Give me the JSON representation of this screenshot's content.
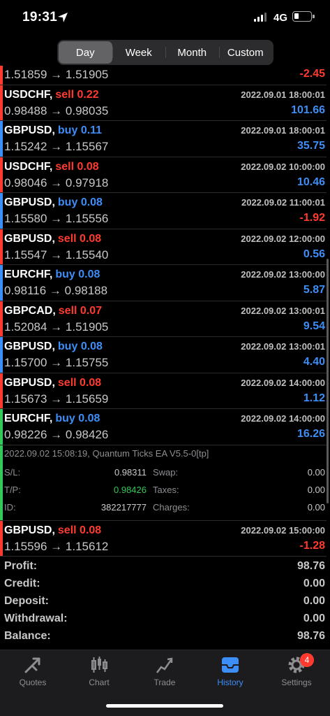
{
  "status_bar": {
    "time": "19:31",
    "network": "4G"
  },
  "period_tabs": [
    {
      "label": "Day",
      "active": true
    },
    {
      "label": "Week",
      "active": false
    },
    {
      "label": "Month",
      "active": false
    },
    {
      "label": "Custom",
      "active": false
    }
  ],
  "deals": [
    {
      "symbol": "",
      "side": "",
      "volume": "",
      "datetime": "",
      "prices": "1.51859 → 1.51905",
      "profit": "-2.45",
      "profit_sign": "neg"
    },
    {
      "symbol": "USDCHF,",
      "side": "sell",
      "volume": "0.22",
      "datetime": "2022.09.01 18:00:01",
      "prices": "0.98488 → 0.98035",
      "profit": "101.66",
      "profit_sign": "pos"
    },
    {
      "symbol": "GBPUSD,",
      "side": "buy",
      "volume": "0.11",
      "datetime": "2022.09.01 18:00:01",
      "prices": "1.15242 → 1.15567",
      "profit": "35.75",
      "profit_sign": "pos"
    },
    {
      "symbol": "USDCHF,",
      "side": "sell",
      "volume": "0.08",
      "datetime": "2022.09.02 10:00:00",
      "prices": "0.98046 → 0.97918",
      "profit": "10.46",
      "profit_sign": "pos"
    },
    {
      "symbol": "GBPUSD,",
      "side": "buy",
      "volume": "0.08",
      "datetime": "2022.09.02 11:00:01",
      "prices": "1.15580 → 1.15556",
      "profit": "-1.92",
      "profit_sign": "neg"
    },
    {
      "symbol": "GBPUSD,",
      "side": "sell",
      "volume": "0.08",
      "datetime": "2022.09.02 12:00:00",
      "prices": "1.15547 → 1.15540",
      "profit": "0.56",
      "profit_sign": "pos"
    },
    {
      "symbol": "EURCHF,",
      "side": "buy",
      "volume": "0.08",
      "datetime": "2022.09.02 13:00:00",
      "prices": "0.98116 → 0.98188",
      "profit": "5.87",
      "profit_sign": "pos"
    },
    {
      "symbol": "GBPCAD,",
      "side": "sell",
      "volume": "0.07",
      "datetime": "2022.09.02 13:00:01",
      "prices": "1.52084 → 1.51905",
      "profit": "9.54",
      "profit_sign": "pos"
    },
    {
      "symbol": "GBPUSD,",
      "side": "buy",
      "volume": "0.08",
      "datetime": "2022.09.02 13:00:01",
      "prices": "1.15700 → 1.15755",
      "profit": "4.40",
      "profit_sign": "pos"
    },
    {
      "symbol": "GBPUSD,",
      "side": "sell",
      "volume": "0.08",
      "datetime": "2022.09.02 14:00:00",
      "prices": "1.15673 → 1.15659",
      "profit": "1.12",
      "profit_sign": "pos"
    },
    {
      "symbol": "EURCHF,",
      "side": "buy",
      "volume": "0.08",
      "datetime": "2022.09.02 14:00:00",
      "prices": "0.98226 → 0.98426",
      "profit": "16.26",
      "profit_sign": "pos"
    }
  ],
  "expanded_detail": {
    "comment": "2022.09.02 15:08:19, Quantum Ticks EA V5.5-0[tp]",
    "sl_label": "S/L:",
    "sl_value": "0.98311",
    "tp_label": "T/P:",
    "tp_value": "0.98426",
    "id_label": "ID:",
    "id_value": "382217777",
    "swap_label": "Swap:",
    "swap_value": "0.00",
    "taxes_label": "Taxes:",
    "taxes_value": "0.00",
    "charges_label": "Charges:",
    "charges_value": "0.00"
  },
  "last_deal": {
    "symbol": "GBPUSD,",
    "side": "sell",
    "volume": "0.08",
    "datetime": "2022.09.02 15:00:00",
    "prices": "1.15596 → 1.15612",
    "profit": "-1.28",
    "profit_sign": "neg"
  },
  "summary": [
    {
      "label": "Profit:",
      "value": "98.76"
    },
    {
      "label": "Credit:",
      "value": "0.00"
    },
    {
      "label": "Deposit:",
      "value": "0.00"
    },
    {
      "label": "Withdrawal:",
      "value": "0.00"
    },
    {
      "label": "Balance:",
      "value": "98.76"
    }
  ],
  "tabs": [
    {
      "label": "Quotes",
      "icon": "quotes-icon"
    },
    {
      "label": "Chart",
      "icon": "chart-icon"
    },
    {
      "label": "Trade",
      "icon": "trade-icon"
    },
    {
      "label": "History",
      "icon": "history-icon",
      "active": true
    },
    {
      "label": "Settings",
      "icon": "settings-icon",
      "badge": "4"
    }
  ],
  "colors": {
    "buy": "#3e8ef7",
    "sell": "#ff3b30",
    "accent": "#3e8ef7",
    "tp_value": "#34c759"
  }
}
